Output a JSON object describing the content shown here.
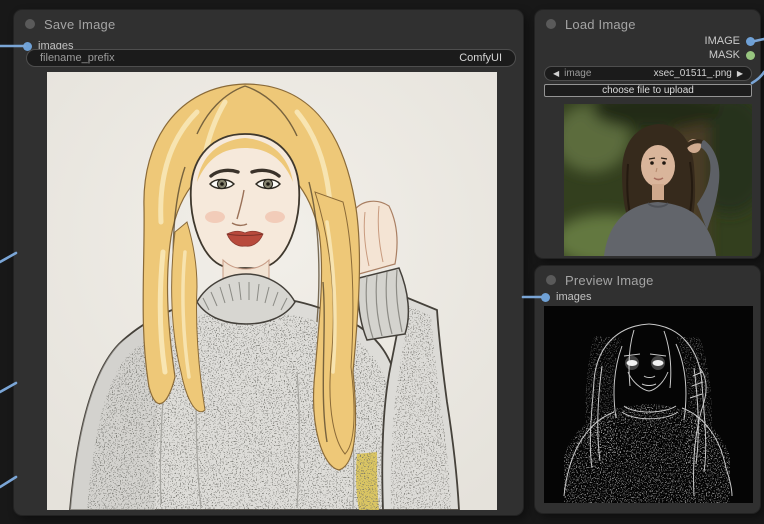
{
  "app": {
    "name": "ComfyUI node graph"
  },
  "colors": {
    "canvas_bg": "#181818",
    "node_bg": "#303030",
    "wire_blue": "#7aa5d6",
    "image_slot_blue": "#6fa1d6",
    "mask_slot_green": "#97c57f"
  },
  "save_image_node": {
    "title": "Save Image",
    "input_images_label": "images",
    "filename_prefix_label": "filename_prefix",
    "filename_prefix_value": "ComfyUI",
    "preview_description": "watercolor illustration of a blonde woman in a light gray knit sweater, hand raised to her head"
  },
  "load_image_node": {
    "title": "Load Image",
    "output_image_label": "IMAGE",
    "output_mask_label": "MASK",
    "combo_left_arrow": "◀",
    "combo_label": "image",
    "combo_value": "xsec_01511_.png",
    "combo_right_arrow": "▶",
    "upload_button_label": "choose file to upload",
    "photo_description": "photo of a brown-haired woman in a gray sweater outdoors"
  },
  "preview_image_node": {
    "title": "Preview Image",
    "input_images_label": "images",
    "preview_description": "black and white edge-detection map of the woman"
  }
}
